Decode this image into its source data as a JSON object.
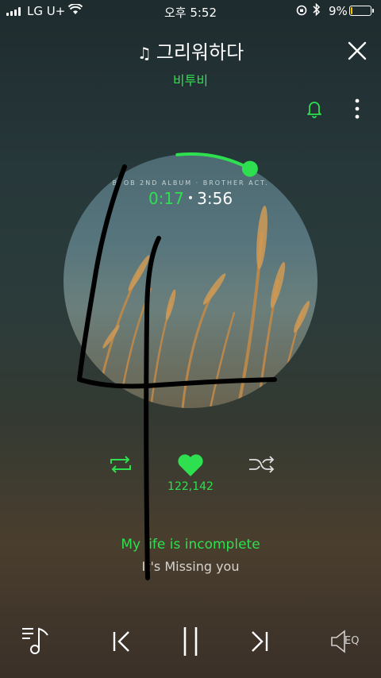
{
  "status_bar": {
    "carrier": "LG U+",
    "time": "오후 5:52",
    "battery_percent": "9%",
    "battery_level": 0.09,
    "battery_color": "#f5c400"
  },
  "header": {
    "song_title": "그리워하다",
    "artist": "비투비",
    "title_icon": "music-note-icon",
    "close_icon": "close-icon",
    "bell_icon": "bell-icon",
    "more_icon": "more-vertical-icon"
  },
  "player": {
    "album_line": "BTOB 2ND ALBUM · BROTHER ACT.",
    "current_time": "0:17",
    "total_time": "3:56",
    "progress": 0.072,
    "like_count": "122,142",
    "accent_color": "#2ee04f"
  },
  "lyrics": {
    "current": "My life is incomplete",
    "next": "It's Missing you"
  },
  "controls": {
    "playlist_icon": "playlist-icon",
    "prev_icon": "previous-icon",
    "pause_icon": "pause-icon",
    "next_icon": "next-icon",
    "eq_label": "EQ",
    "repeat_icon": "repeat-icon",
    "heart_icon": "heart-icon",
    "shuffle_icon": "shuffle-icon"
  }
}
